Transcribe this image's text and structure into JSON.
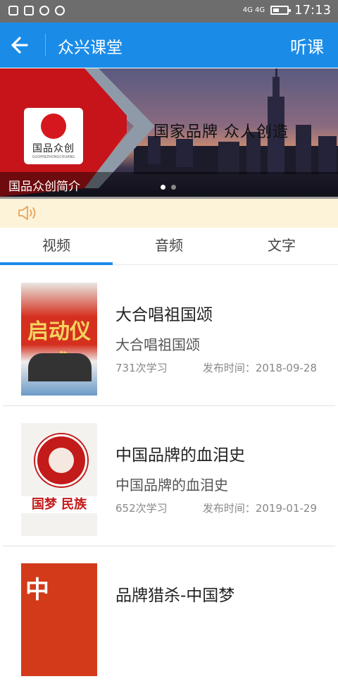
{
  "status_bar": {
    "time": "17:13",
    "network": "4G 4G"
  },
  "header": {
    "title": "众兴课堂",
    "action": "听课"
  },
  "banner": {
    "logo_text": "国品众创",
    "logo_sub": "GUOPINZHONGCHUANG",
    "slogan": "国家品牌 众人创造",
    "caption": "国品众创简介",
    "active_dot": 1,
    "dot_count": 2
  },
  "tabs": [
    {
      "label": "视频",
      "active": true
    },
    {
      "label": "音频",
      "active": false
    },
    {
      "label": "文字",
      "active": false
    }
  ],
  "courses": [
    {
      "title": "大合唱祖国颂",
      "subtitle": "大合唱祖国颂",
      "count": "731次学习",
      "date": "发布时间：2018-09-28"
    },
    {
      "title": "中国品牌的血泪史",
      "subtitle": "中国品牌的血泪史",
      "count": "652次学习",
      "date": "发布时间：2019-01-29"
    },
    {
      "title": "品牌猎杀-中国梦",
      "subtitle": "",
      "count": "",
      "date": ""
    }
  ],
  "thumb_text": {
    "t1": "启动仪式",
    "t2": "国梦 民族",
    "t3": "中"
  },
  "colors": {
    "primary": "#1a8ce8",
    "status_bar": "#6d6d6d",
    "notice_bg": "#fdf3d8",
    "brand_red": "#c6141a"
  }
}
